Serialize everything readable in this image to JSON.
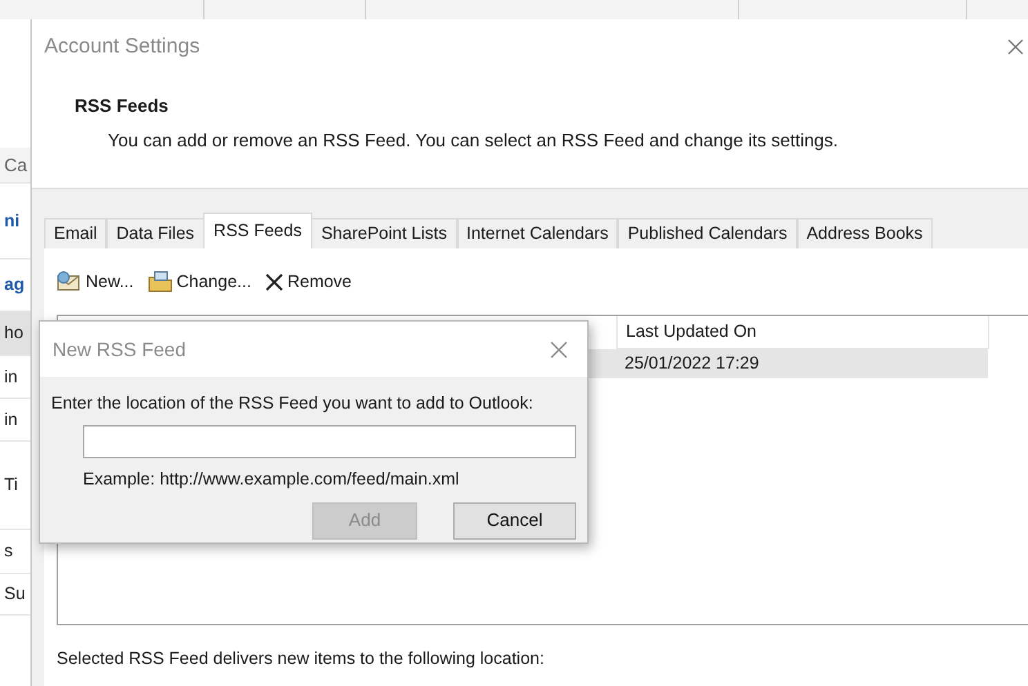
{
  "background_app": {
    "sidebar_fragments": [
      {
        "text": "Ca",
        "kind": "heading"
      },
      {
        "text": "ni",
        "kind": "link"
      },
      {
        "text": "ag",
        "kind": "link"
      },
      {
        "text": "ho",
        "kind": "selected"
      },
      {
        "text": "in",
        "kind": "plain"
      },
      {
        "text": "in",
        "kind": "plain"
      },
      {
        "text": "Ti",
        "kind": "plain"
      },
      {
        "text": "s",
        "kind": "plain"
      },
      {
        "text": "Su",
        "kind": "plain"
      }
    ]
  },
  "account_settings": {
    "title": "Account Settings",
    "heading": "RSS Feeds",
    "description": "You can add or remove an RSS Feed. You can select an RSS Feed and change its settings.",
    "tabs": [
      {
        "label": "Email",
        "selected": false
      },
      {
        "label": "Data Files",
        "selected": false
      },
      {
        "label": "RSS Feeds",
        "selected": true
      },
      {
        "label": "SharePoint Lists",
        "selected": false
      },
      {
        "label": "Internet Calendars",
        "selected": false
      },
      {
        "label": "Published Calendars",
        "selected": false
      },
      {
        "label": "Address Books",
        "selected": false
      }
    ],
    "toolbar": [
      {
        "label": "New...",
        "kind": "new"
      },
      {
        "label": "Change...",
        "kind": "change"
      },
      {
        "label": "Remove",
        "kind": "remove"
      }
    ],
    "feed_list": {
      "columns": [
        "Last Updated On"
      ],
      "rows": [
        {
          "cells": [
            "25/01/2022 17:29"
          ],
          "selected": true
        }
      ]
    },
    "location_label": "Selected RSS Feed delivers new items to the following location:"
  },
  "new_feed_dialog": {
    "title": "New RSS Feed",
    "prompt": "Enter the location of the RSS Feed you want to add to Outlook:",
    "example": "Example: http://www.example.com/feed/main.xml",
    "buttons": [
      {
        "label": "Add",
        "disabled": true
      },
      {
        "label": "Cancel",
        "disabled": false
      }
    ]
  }
}
